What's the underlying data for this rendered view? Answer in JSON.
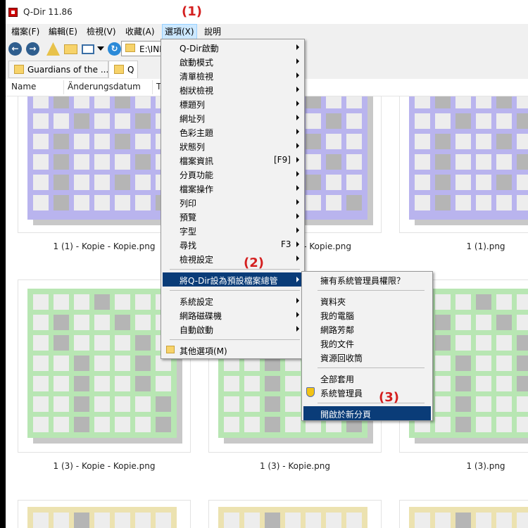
{
  "window": {
    "title": "Q-Dir 11.86"
  },
  "menubar": [
    "檔案(F)",
    "編輯(E)",
    "檢視(V)",
    "收藏(A)",
    "選項(X)",
    "說明"
  ],
  "address": {
    "path": "E:\\INI"
  },
  "tabs": [
    "Guardians of the ...",
    "Q"
  ],
  "columns": [
    "Name",
    "Änderungsdatum",
    "T"
  ],
  "files": [
    "1 (1) - Kopie - Kopie.png",
    "1 (1) - Kopie.png",
    "1 (1).png",
    "1 (3) - Kopie - Kopie.png",
    "1 (3) - Kopie.png",
    "1 (3).png"
  ],
  "options_menu": [
    {
      "label": "Q-Dir啟動",
      "submenu": true
    },
    {
      "label": "啟動模式",
      "submenu": true
    },
    {
      "label": "清單檢視",
      "submenu": true
    },
    {
      "label": "樹狀檢視",
      "submenu": true
    },
    {
      "label": "標題列",
      "submenu": true
    },
    {
      "label": "網址列",
      "submenu": true
    },
    {
      "label": "色彩主題",
      "submenu": true
    },
    {
      "label": "狀態列",
      "submenu": true
    },
    {
      "label": "檔案資訊",
      "shortcut": "[F9]",
      "submenu": true
    },
    {
      "label": "分頁功能",
      "submenu": true
    },
    {
      "label": "檔案操作",
      "submenu": true
    },
    {
      "label": "列印",
      "submenu": true
    },
    {
      "label": "預覽",
      "submenu": true
    },
    {
      "label": "字型",
      "submenu": true
    },
    {
      "label": "尋找",
      "shortcut": "F3",
      "submenu": true
    },
    {
      "label": "檢視設定",
      "submenu": true
    },
    {
      "label": "將Q-Dir設為預設檔案總管",
      "submenu": true,
      "highlighted": true
    },
    {
      "label": "系統設定",
      "submenu": true
    },
    {
      "label": "網路磁碟機",
      "submenu": true
    },
    {
      "label": "自動啟動",
      "submenu": true
    },
    {
      "label": "其他選項(M)",
      "submenu": false
    }
  ],
  "submenu": [
    {
      "label": "擁有系統管理員權限？"
    },
    {
      "label": "資料夾"
    },
    {
      "label": "我的電腦"
    },
    {
      "label": "網路芳鄰"
    },
    {
      "label": "我的文件"
    },
    {
      "label": "資源回收筒"
    },
    {
      "label": "全部套用"
    },
    {
      "label": "系統管理員",
      "icon": "shield-icon"
    },
    {
      "label": "開啟於新分頁",
      "highlighted": true
    }
  ],
  "callouts": [
    "(1)",
    "(2)",
    "(3)"
  ],
  "colors": {
    "purple": "#b9b4ee",
    "green": "#b8e6b3",
    "yellow": "#ece2b0",
    "cell": "#ededed",
    "dark": "#b5b5b5",
    "highlight": "#0a3c78"
  }
}
